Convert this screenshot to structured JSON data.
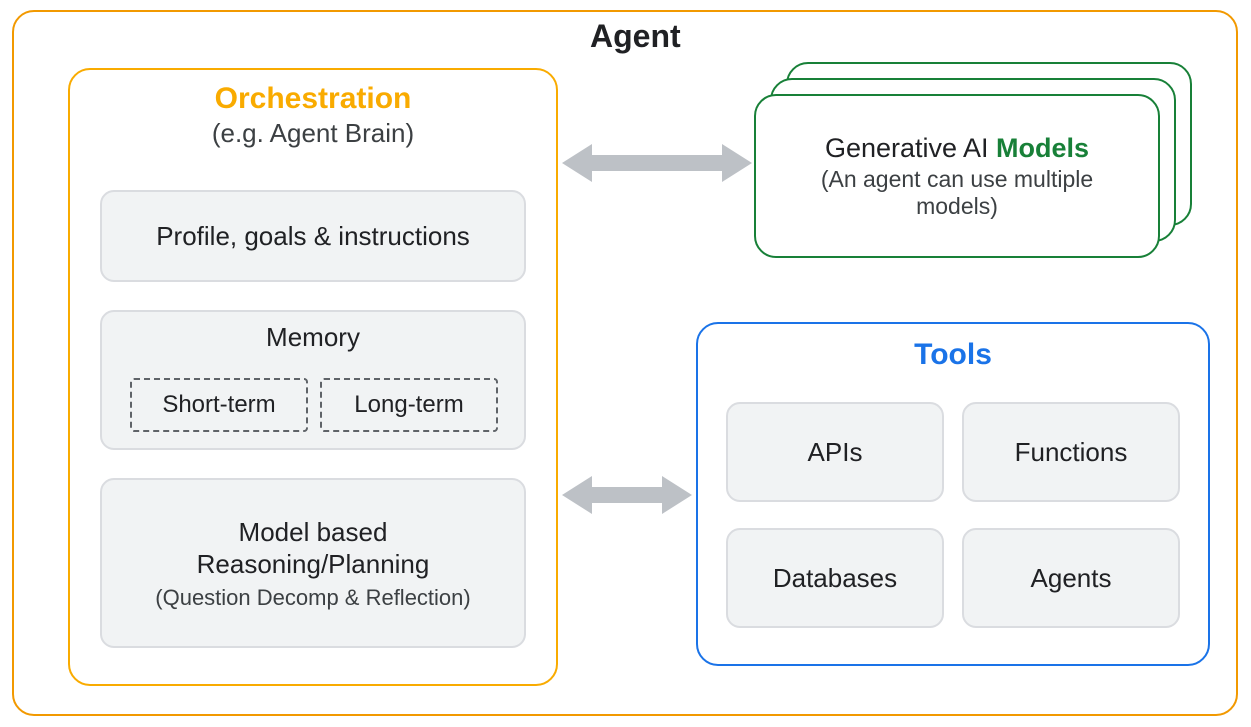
{
  "agent": {
    "title": "Agent"
  },
  "orchestration": {
    "title": "Orchestration",
    "subtitle": "(e.g. Agent Brain)",
    "profile_box": "Profile, goals & instructions",
    "memory_title": "Memory",
    "memory_short": "Short-term",
    "memory_long": "Long-term",
    "reasoning_line1": "Model based",
    "reasoning_line2": "Reasoning/Planning",
    "reasoning_sub": "(Question Decomp & Reflection)"
  },
  "models": {
    "prefix": "Generative AI ",
    "highlight": "Models",
    "sub1": "(An agent can use multiple",
    "sub2": "models)"
  },
  "tools": {
    "title": "Tools",
    "items": [
      "APIs",
      "Functions",
      "Databases",
      "Agents"
    ]
  },
  "colors": {
    "orange": "#f29900",
    "yellow": "#f9ab00",
    "green": "#188038",
    "blue": "#1a73e8",
    "grey_border": "#dadce0",
    "grey_fill": "#f1f3f4",
    "arrow": "#bdc1c6",
    "text": "#202124"
  }
}
